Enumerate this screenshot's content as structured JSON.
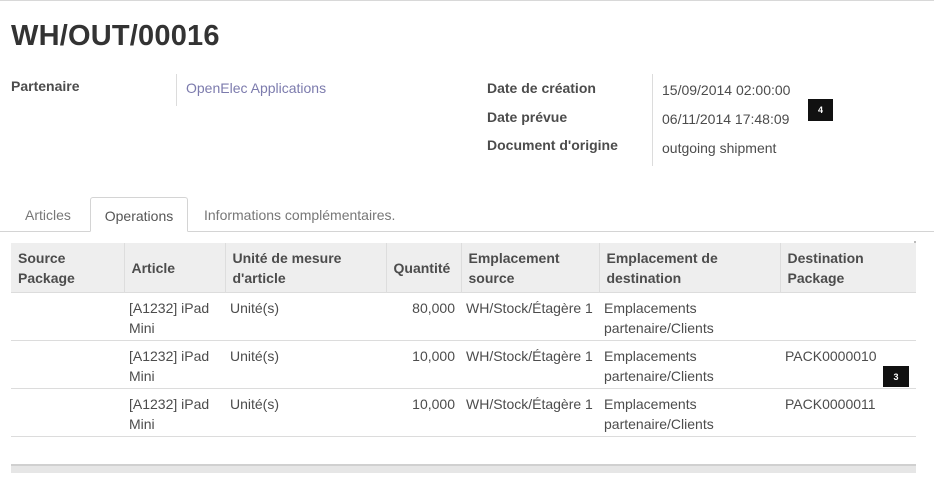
{
  "record": {
    "title": "WH/OUT/00016"
  },
  "fields": {
    "partner_label": "Partenaire",
    "partner_value": "OpenElec Applications",
    "creation_date_label": "Date de création",
    "creation_date_value": "15/09/2014 02:00:00",
    "scheduled_date_label": "Date prévue",
    "scheduled_date_value": "06/11/2014 17:48:09",
    "origin_label": "Document d'origine",
    "origin_value": "outgoing shipment"
  },
  "annotations": {
    "badge_top": "4",
    "badge_table": "3"
  },
  "tabs": [
    {
      "label": "Articles"
    },
    {
      "label": "Operations"
    },
    {
      "label": "Informations complémentaires."
    }
  ],
  "table": {
    "headers": [
      "Source Package",
      "Article",
      "Unité de mesure d'article",
      "Quantité",
      "Emplacement source",
      "Emplacement de destination",
      "Destination Package"
    ],
    "rows": [
      {
        "source_package": "",
        "article": "[A1232] iPad Mini",
        "uom": "Unité(s)",
        "quantity": "80,000",
        "source_location": "WH/Stock/Étagère 1",
        "dest_location": "Emplacements partenaire/Clients",
        "dest_package": ""
      },
      {
        "source_package": "",
        "article": "[A1232] iPad Mini",
        "uom": "Unité(s)",
        "quantity": "10,000",
        "source_location": "WH/Stock/Étagère 1",
        "dest_location": "Emplacements partenaire/Clients",
        "dest_package": "PACK0000010"
      },
      {
        "source_package": "",
        "article": "[A1232] iPad Mini",
        "uom": "Unité(s)",
        "quantity": "10,000",
        "source_location": "WH/Stock/Étagère 1",
        "dest_location": "Emplacements partenaire/Clients",
        "dest_package": "PACK0000011"
      }
    ]
  }
}
